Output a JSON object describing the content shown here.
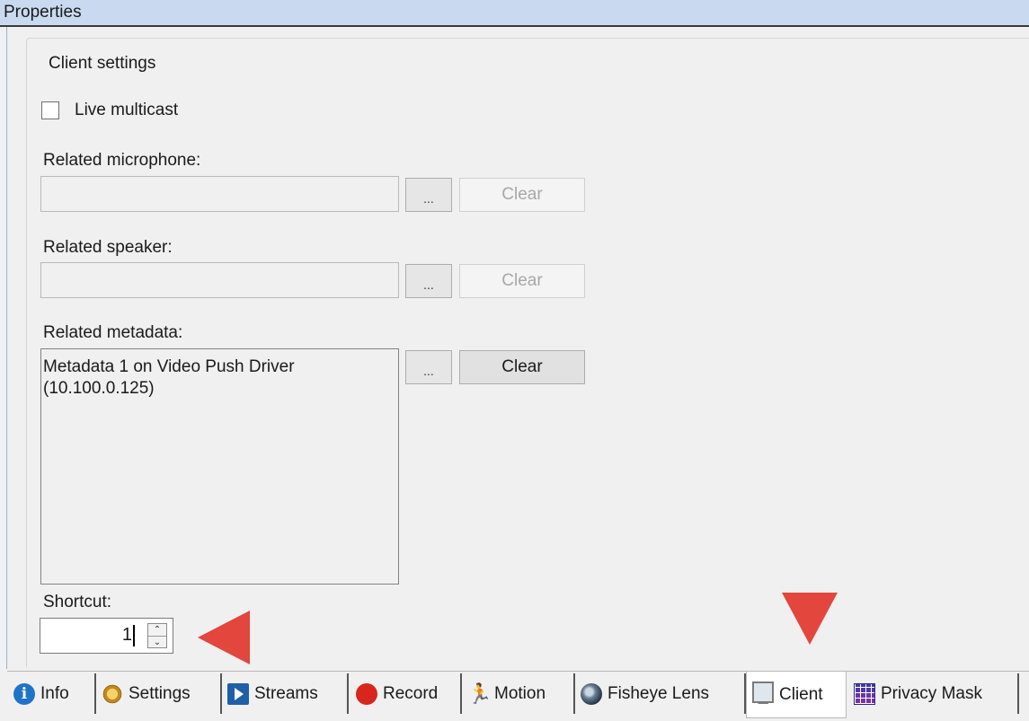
{
  "window": {
    "title": "Properties"
  },
  "group": {
    "title": "Client settings"
  },
  "live_multicast": {
    "label": "Live multicast",
    "checked": false
  },
  "microphone": {
    "label": "Related microphone:",
    "value": "",
    "browse_label": "...",
    "clear_label": "Clear"
  },
  "speaker": {
    "label": "Related speaker:",
    "value": "",
    "browse_label": "...",
    "clear_label": "Clear"
  },
  "metadata": {
    "label": "Related metadata:",
    "lines": [
      "Metadata 1 on Video Push Driver",
      "(10.100.0.125)"
    ],
    "browse_label": "...",
    "clear_label": "Clear"
  },
  "shortcut": {
    "label": "Shortcut:",
    "value": "1"
  },
  "tabs": [
    {
      "label": "Info",
      "icon": "info-icon"
    },
    {
      "label": "Settings",
      "icon": "settings-icon"
    },
    {
      "label": "Streams",
      "icon": "streams-icon"
    },
    {
      "label": "Record",
      "icon": "record-icon"
    },
    {
      "label": "Motion",
      "icon": "motion-icon"
    },
    {
      "label": "Fisheye Lens",
      "icon": "fisheye-icon"
    },
    {
      "label": "Client",
      "icon": "client-icon",
      "active": true
    },
    {
      "label": "Privacy Mask",
      "icon": "privacy-mask-icon"
    }
  ],
  "annotation_color": "#e2463c"
}
